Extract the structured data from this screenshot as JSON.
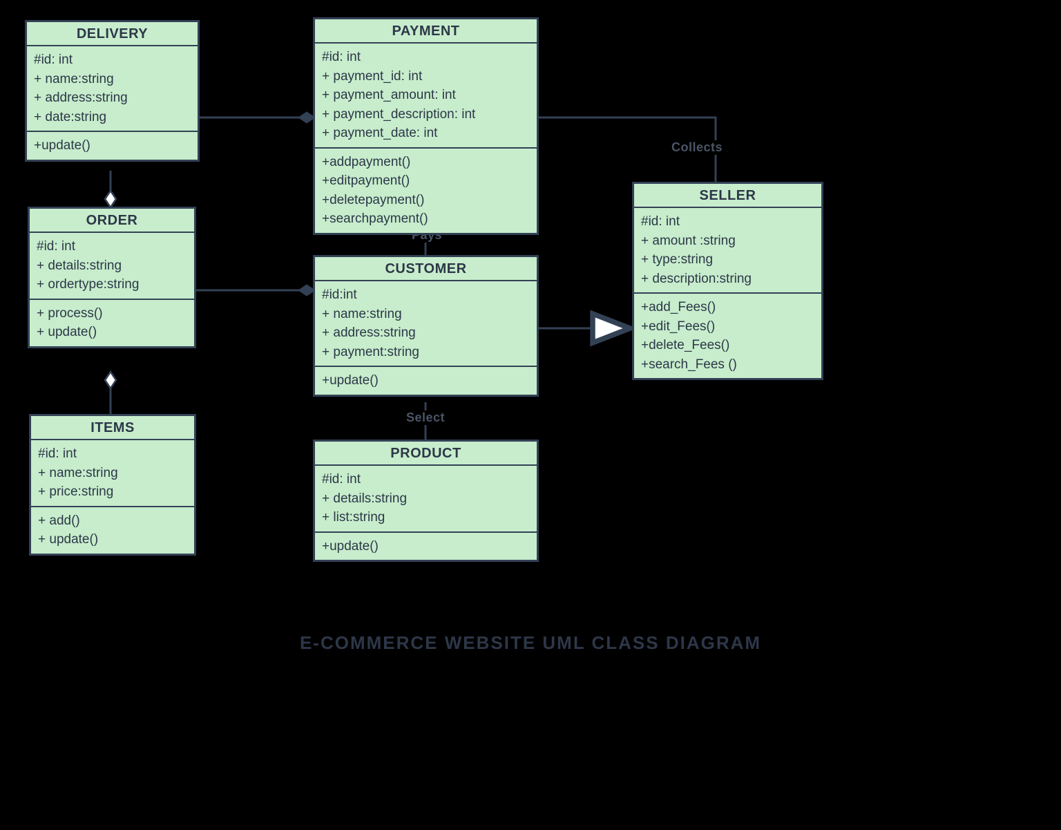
{
  "caption": "E-COMMERCE WEBSITE UML CLASS DIAGRAM",
  "labels": {
    "collects": "Collects",
    "pays": "Pays",
    "select": "Select"
  },
  "classes": {
    "delivery": {
      "name": "DELIVERY",
      "attrs": [
        "#id: int",
        "+ name:string",
        "+ address:string",
        "+ date:string"
      ],
      "ops": [
        "+update()"
      ]
    },
    "order": {
      "name": "ORDER",
      "attrs": [
        "#id: int",
        "+ details:string",
        "+ ordertype:string"
      ],
      "ops": [
        "+ process()",
        "+ update()"
      ]
    },
    "items": {
      "name": "ITEMS",
      "attrs": [
        "#id: int",
        "+ name:string",
        "+ price:string"
      ],
      "ops": [
        "+ add()",
        "+ update()"
      ]
    },
    "payment": {
      "name": "PAYMENT",
      "attrs": [
        "#id: int",
        "+ payment_id: int",
        "+ payment_amount: int",
        "+ payment_description: int",
        "+ payment_date: int"
      ],
      "ops": [
        "+addpayment()",
        "+editpayment()",
        "+deletepayment()",
        "+searchpayment()"
      ]
    },
    "customer": {
      "name": "CUSTOMER",
      "attrs": [
        "#id:int",
        "+ name:string",
        "+ address:string",
        "+ payment:string"
      ],
      "ops": [
        "+update()"
      ]
    },
    "product": {
      "name": "PRODUCT",
      "attrs": [
        "#id: int",
        "+ details:string",
        "+ list:string"
      ],
      "ops": [
        "+update()"
      ]
    },
    "seller": {
      "name": "SELLER",
      "attrs": [
        "#id: int",
        "+ amount :string",
        "+ type:string",
        "+ description:string"
      ],
      "ops": [
        "+add_Fees()",
        "+edit_Fees()",
        "+delete_Fees()",
        "+search_Fees ()"
      ]
    }
  },
  "chart_data": {
    "type": "uml-class-diagram",
    "title": "E-COMMERCE WEBSITE UML CLASS DIAGRAM",
    "classes": [
      {
        "name": "DELIVERY",
        "attributes": [
          "#id: int",
          "+ name:string",
          "+ address:string",
          "+ date:string"
        ],
        "operations": [
          "+update()"
        ]
      },
      {
        "name": "ORDER",
        "attributes": [
          "#id: int",
          "+ details:string",
          "+ ordertype:string"
        ],
        "operations": [
          "+ process()",
          "+ update()"
        ]
      },
      {
        "name": "ITEMS",
        "attributes": [
          "#id: int",
          "+ name:string",
          "+ price:string"
        ],
        "operations": [
          "+ add()",
          "+ update()"
        ]
      },
      {
        "name": "PAYMENT",
        "attributes": [
          "#id: int",
          "+ payment_id: int",
          "+ payment_amount: int",
          "+ payment_description: int",
          "+ payment_date: int"
        ],
        "operations": [
          "+addpayment()",
          "+editpayment()",
          "+deletepayment()",
          "+searchpayment()"
        ]
      },
      {
        "name": "CUSTOMER",
        "attributes": [
          "#id:int",
          "+ name:string",
          "+ address:string",
          "+ payment:string"
        ],
        "operations": [
          "+update()"
        ]
      },
      {
        "name": "PRODUCT",
        "attributes": [
          "#id: int",
          "+ details:string",
          "+ list:string"
        ],
        "operations": [
          "+update()"
        ]
      },
      {
        "name": "SELLER",
        "attributes": [
          "#id: int",
          "+ amount :string",
          "+ type:string",
          "+ description:string"
        ],
        "operations": [
          "+add_Fees()",
          "+edit_Fees()",
          "+delete_Fees()",
          "+search_Fees ()"
        ]
      }
    ],
    "relations": [
      {
        "from": "DELIVERY",
        "to": "PAYMENT",
        "type": "composition",
        "end": "PAYMENT-side-diamond-filled"
      },
      {
        "from": "DELIVERY",
        "to": "ORDER",
        "type": "aggregation",
        "end": "ORDER-side-diamond-hollow"
      },
      {
        "from": "ORDER",
        "to": "ITEMS",
        "type": "aggregation",
        "end": "ITEMS-side-diamond-hollow"
      },
      {
        "from": "ORDER",
        "to": "CUSTOMER",
        "type": "composition",
        "end": "CUSTOMER-side-diamond-filled"
      },
      {
        "from": "CUSTOMER",
        "to": "PAYMENT",
        "type": "association",
        "label": "Pays"
      },
      {
        "from": "CUSTOMER",
        "to": "PRODUCT",
        "type": "association",
        "label": "Select"
      },
      {
        "from": "CUSTOMER",
        "to": "SELLER",
        "type": "generalization",
        "arrow": "hollow-triangle-at-SELLER"
      },
      {
        "from": "PAYMENT",
        "to": "SELLER",
        "type": "association",
        "label": "Collects"
      }
    ]
  }
}
